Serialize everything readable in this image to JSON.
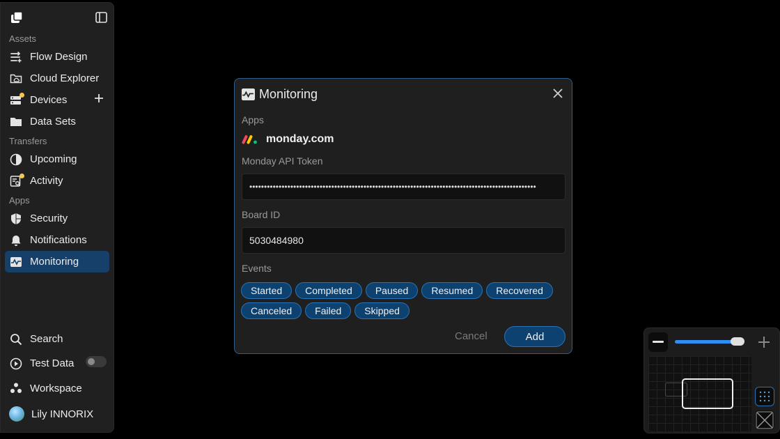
{
  "sidebar": {
    "sections": {
      "assets": "Assets",
      "transfers": "Transfers",
      "apps": "Apps"
    },
    "assets_items": [
      {
        "label": "Flow Design",
        "icon": "flow-icon"
      },
      {
        "label": "Cloud Explorer",
        "icon": "cloud-folder-icon"
      },
      {
        "label": "Devices",
        "icon": "devices-icon"
      },
      {
        "label": "Data Sets",
        "icon": "folder-icon"
      }
    ],
    "transfers_items": [
      {
        "label": "Upcoming",
        "icon": "pie-icon"
      },
      {
        "label": "Activity",
        "icon": "activity-icon"
      }
    ],
    "apps_items": [
      {
        "label": "Security",
        "icon": "shield-icon"
      },
      {
        "label": "Notifications",
        "icon": "bell-icon"
      },
      {
        "label": "Monitoring",
        "icon": "pulse-icon"
      }
    ],
    "bottom_items": [
      {
        "label": "Search",
        "icon": "search-icon"
      },
      {
        "label": "Test Data",
        "icon": "play-circle-icon"
      },
      {
        "label": "Workspace",
        "icon": "workspace-icon"
      },
      {
        "label": "Lily INNORIX",
        "icon": "avatar"
      }
    ]
  },
  "dialog": {
    "title": "Monitoring",
    "apps_label": "Apps",
    "app_name": "monday.com",
    "token_label": "Monday API Token",
    "token_value": "••••••••••••••••••••••••••••••••••••••••••••••••••••••••••••••••••••••••••••••••••••••••••••••••••",
    "board_label": "Board ID",
    "board_value": "5030484980",
    "events_label": "Events",
    "events_row1": [
      "Started",
      "Completed",
      "Paused",
      "Resumed",
      "Recovered"
    ],
    "events_row2": [
      "Canceled",
      "Failed",
      "Skipped"
    ],
    "cancel_label": "Cancel",
    "add_label": "Add"
  },
  "minimap": {
    "zoom_fraction": 0.9
  },
  "colors": {
    "accent": "#2f8ef0",
    "chip_bg": "#0d4170",
    "notice_dot": "#f2c94c"
  }
}
